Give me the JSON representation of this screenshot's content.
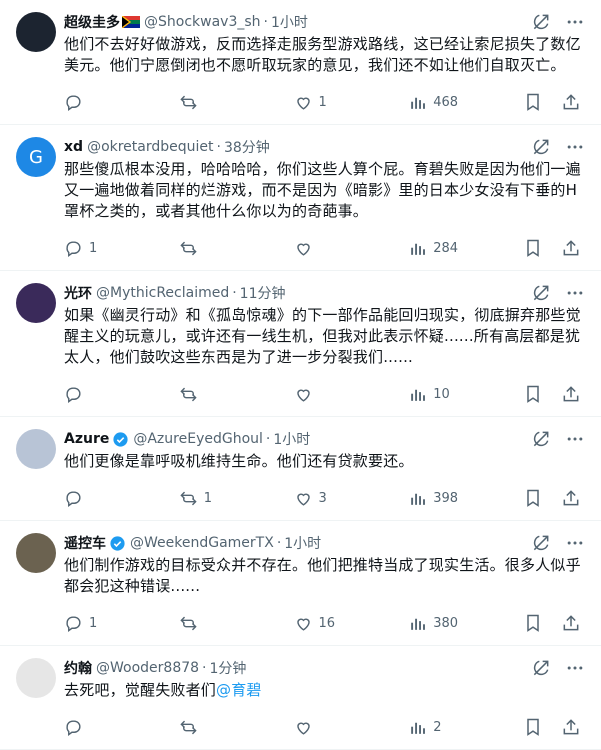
{
  "tweets": [
    {
      "name": "超级圭多",
      "handle": "@Shockwav3_sh",
      "time": "1小时",
      "text": "他们不去好好做游戏，反而选择走服务型游戏路线，这已经让索尼损失了数亿美元。他们宁愿倒闭也不愿听取玩家的意见，我们还不如让他们自取灭亡。",
      "replies": "",
      "retweets": "",
      "likes": "1",
      "views": "468",
      "verified": false,
      "flag": true,
      "avatar_color": "#1c2430"
    },
    {
      "name": "xd",
      "handle": "@okretardbequiet",
      "time": "38分钟",
      "text": "那些傻瓜根本没用，哈哈哈哈，你们这些人算个屁。育碧失败是因为他们一遍又一遍地做着同样的烂游戏，而不是因为《暗影》里的日本少女没有下垂的H罩杯之类的，或者其他什么你以为的奇葩事。",
      "replies": "1",
      "retweets": "",
      "likes": "",
      "views": "284",
      "verified": false,
      "flag": false,
      "avatar_letter": "G",
      "avatar_color": "#1e88e5"
    },
    {
      "name": "光环",
      "handle": "@MythicReclaimed",
      "time": "11分钟",
      "text": "如果《幽灵行动》和《孤岛惊魂》的下一部作品能回归现实，彻底摒弃那些觉醒主义的玩意儿，或许还有一线生机，但我对此表示怀疑......所有高层都是犹太人，他们鼓吹这些东西是为了进一步分裂我们......",
      "replies": "",
      "retweets": "",
      "likes": "",
      "views": "10",
      "verified": false,
      "flag": false,
      "avatar_color": "#3a2a5a"
    },
    {
      "name": "Azure",
      "handle": "@AzureEyedGhoul",
      "time": "1小时",
      "text": "他们更像是靠呼吸机维持生命。他们还有贷款要还。",
      "replies": "",
      "retweets": "1",
      "likes": "3",
      "views": "398",
      "verified": true,
      "flag": false,
      "avatar_color": "#b8c4d6"
    },
    {
      "name": "遥控车",
      "handle": "@WeekendGamerTX",
      "time": "1小时",
      "text": "他们制作游戏的目标受众并不存在。他们把推特当成了现实生活。很多人似乎都会犯这种错误......",
      "replies": "1",
      "retweets": "",
      "likes": "16",
      "views": "380",
      "verified": true,
      "flag": false,
      "avatar_color": "#6b6250"
    },
    {
      "name": "约翰",
      "handle": "@Wooder8878",
      "time": "1分钟",
      "text": "去死吧，觉醒失败者们",
      "mention": "@育碧",
      "replies": "",
      "retweets": "",
      "likes": "",
      "views": "2",
      "verified": false,
      "flag": false,
      "avatar_color": "#e6e6e6"
    }
  ],
  "colors": {
    "accent": "#1d9bf0",
    "muted": "#536471",
    "border": "#eff3f4"
  },
  "icons": [
    "grok-icon",
    "more-icon",
    "reply-icon",
    "retweet-icon",
    "like-icon",
    "views-icon",
    "bookmark-icon",
    "share-icon",
    "verified-icon",
    "flag-icon"
  ]
}
